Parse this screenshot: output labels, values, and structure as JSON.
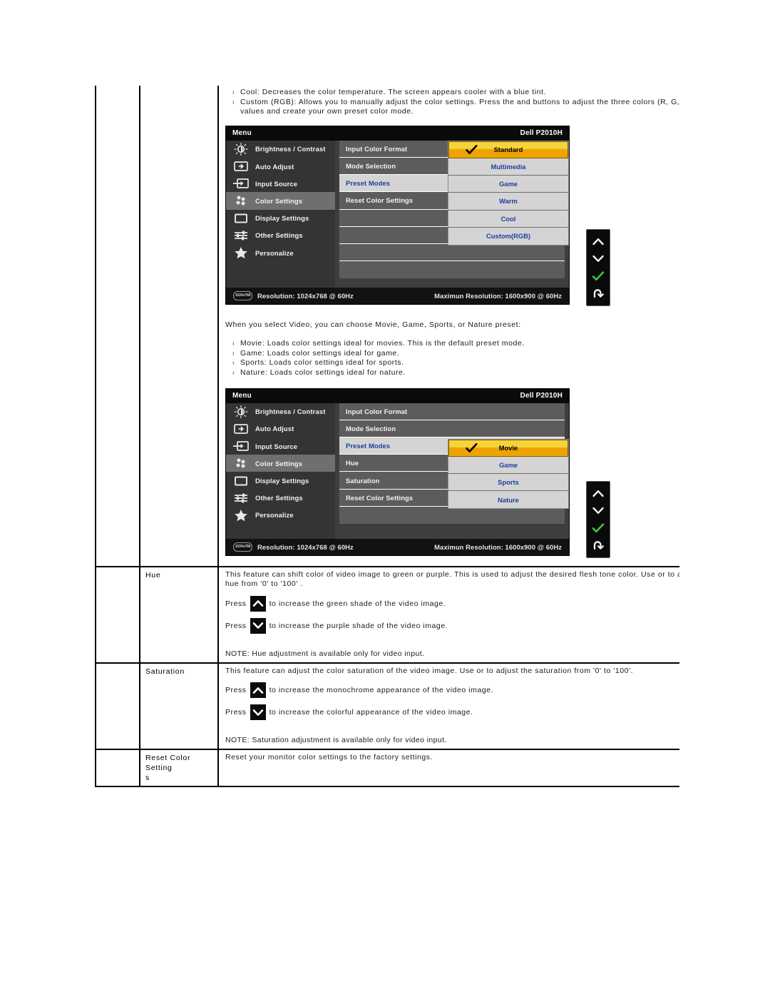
{
  "document": {
    "intro_bullets": [
      {
        "text": "Cool: Decreases the color temperature. The screen appears cooler with a blue tint."
      },
      {
        "text": "Custom (RGB): Allows you to manually adjust the color settings. Press the and buttons to adjust the three colors (R, G,",
        "cont": "values and create your own preset color mode."
      }
    ],
    "video_intro": "When you select Video, you can choose Movie, Game, Sports, or Nature preset:",
    "video_bullets": [
      "Movie: Loads color settings ideal for movies. This is the default preset mode.",
      "Game: Loads color settings ideal for game.",
      "Sports: Loads color settings ideal for sports.",
      "Nature: Loads color settings ideal for nature."
    ]
  },
  "osd1": {
    "title_left": "Menu",
    "title_right": "Dell  P2010H",
    "nav_items": [
      {
        "label": "Brightness / Contrast",
        "icon": "brightness-icon",
        "active": false
      },
      {
        "label": "Auto Adjust",
        "icon": "auto-adjust-icon",
        "active": false
      },
      {
        "label": "Input Source",
        "icon": "input-source-icon",
        "active": false
      },
      {
        "label": "Color Settings",
        "icon": "color-settings-icon",
        "active": true
      },
      {
        "label": "Display Settings",
        "icon": "display-settings-icon",
        "active": false
      },
      {
        "label": "Other Settings",
        "icon": "other-settings-icon",
        "active": false
      },
      {
        "label": "Personalize",
        "icon": "personalize-star-icon",
        "active": false
      }
    ],
    "mid_items": [
      {
        "label": "Input Color Format",
        "selected": false
      },
      {
        "label": "Mode Selection",
        "selected": false
      },
      {
        "label": "Preset Modes",
        "selected": true
      },
      {
        "label": "Reset Color Settings",
        "selected": false
      },
      {
        "label": "",
        "selected": false
      },
      {
        "label": "",
        "selected": false
      },
      {
        "label": "",
        "selected": false
      },
      {
        "label": "",
        "selected": false
      }
    ],
    "sub_items": [
      {
        "label": "Standard",
        "highlighted": true
      },
      {
        "label": "Multimedia",
        "highlighted": false
      },
      {
        "label": "Game",
        "highlighted": false
      },
      {
        "label": "Warm",
        "highlighted": false
      },
      {
        "label": "Cool",
        "highlighted": false
      },
      {
        "label": "Custom(RGB)",
        "highlighted": false
      }
    ],
    "footer_badge": "1024x768",
    "footer_left": "Resolution: 1024x768 @ 60Hz",
    "footer_right": "Maximun Resolution: 1600x900 @ 60Hz",
    "buttons": [
      "up-arrow-icon",
      "down-arrow-icon",
      "check-icon",
      "back-icon"
    ]
  },
  "osd2": {
    "title_left": "Menu",
    "title_right": "Dell  P2010H",
    "nav_items": [
      {
        "label": "Brightness / Contrast",
        "icon": "brightness-icon",
        "active": false
      },
      {
        "label": "Auto Adjust",
        "icon": "auto-adjust-icon",
        "active": false
      },
      {
        "label": "Input Source",
        "icon": "input-source-icon",
        "active": false
      },
      {
        "label": "Color Settings",
        "icon": "color-settings-icon",
        "active": true
      },
      {
        "label": "Display Settings",
        "icon": "display-settings-icon",
        "active": false
      },
      {
        "label": "Other Settings",
        "icon": "other-settings-icon",
        "active": false
      },
      {
        "label": "Personalize",
        "icon": "personalize-star-icon",
        "active": false
      }
    ],
    "mid_items": [
      {
        "label": "Input Color Format",
        "selected": false
      },
      {
        "label": "Mode Selection",
        "selected": false
      },
      {
        "label": "Preset Modes",
        "selected": true
      },
      {
        "label": "Hue",
        "selected": false
      },
      {
        "label": "Saturation",
        "selected": false
      },
      {
        "label": "Reset Color Settings",
        "selected": false
      },
      {
        "label": "",
        "selected": false
      }
    ],
    "sub_items": [
      {
        "label": "Movie",
        "highlighted": true
      },
      {
        "label": "Game",
        "highlighted": false
      },
      {
        "label": "Sports",
        "highlighted": false
      },
      {
        "label": "Nature",
        "highlighted": false
      }
    ],
    "footer_badge": "1024x768",
    "footer_left": "Resolution: 1024x768 @ 60Hz",
    "footer_right": "Maximun Resolution: 1600x900 @ 60Hz",
    "buttons": [
      "up-arrow-icon",
      "down-arrow-icon",
      "check-icon",
      "back-icon"
    ]
  },
  "rows": {
    "hue": {
      "name": "Hue",
      "desc_line1": "This feature can shift color of video image to green or purple. This is used to adjust the desired flesh tone color. Use or to adjust the",
      "desc_line2": "hue from '0' to '100' .",
      "press_up_prefix": "Press",
      "press_up_suffix": "to increase the green shade of the video image.",
      "press_down_prefix": "Press",
      "press_down_suffix": "to increase the purple shade of the video image.",
      "note": "NOTE: Hue adjustment is available only for video input."
    },
    "saturation": {
      "name": "Saturation",
      "desc_line1": "This feature can adjust the color saturation of the video image. Use or to adjust the saturation from '0' to '100'.",
      "press_up_prefix": "Press",
      "press_up_suffix": "to increase the monochrome appearance of the video image.",
      "press_down_prefix": "Press",
      "press_down_suffix": "to increase the colorful appearance of the video image.",
      "note": "NOTE: Saturation adjustment is available only for video input."
    },
    "reset": {
      "name": "Reset Color Setting",
      "name_cont": "s",
      "desc": "Reset your monitor color settings to the factory settings."
    }
  }
}
